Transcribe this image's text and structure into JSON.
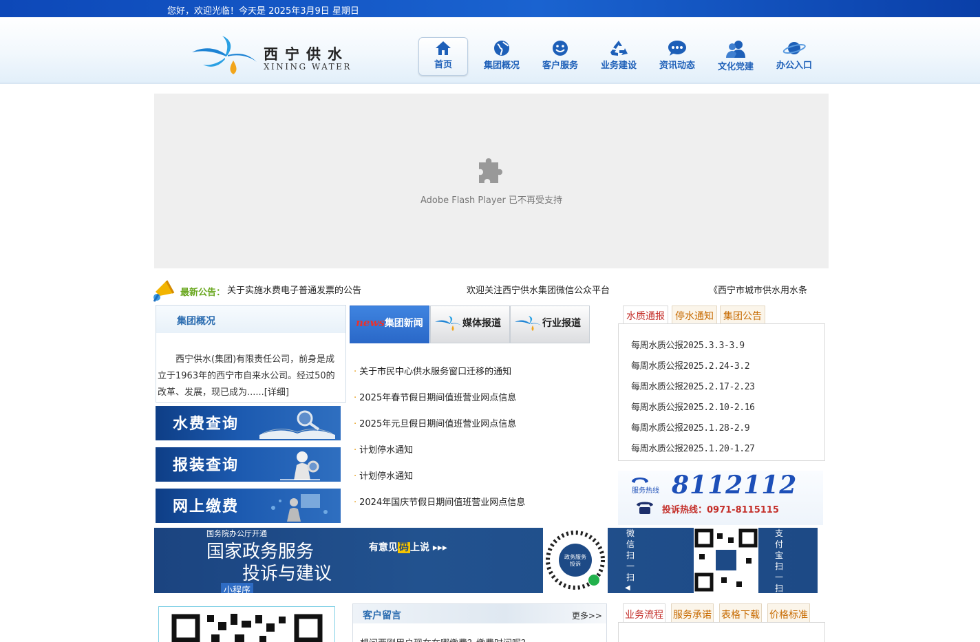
{
  "topbar": {
    "greeting": "您好，欢迎光临！今天是 2025年3月9日 星期日"
  },
  "logo": {
    "cn": "西宁供水",
    "en": "XINING WATER"
  },
  "nav": [
    {
      "label": "首页",
      "icon": "home-icon"
    },
    {
      "label": "集团概况",
      "icon": "globe-icon"
    },
    {
      "label": "客户服务",
      "icon": "smiley-icon"
    },
    {
      "label": "业务建设",
      "icon": "recycle-icon"
    },
    {
      "label": "资讯动态",
      "icon": "chat-icon"
    },
    {
      "label": "文化党建",
      "icon": "users-icon"
    },
    {
      "label": "办公入口",
      "icon": "planet-icon"
    }
  ],
  "flash": {
    "message": "Adobe Flash Player 已不再受支持"
  },
  "notice": {
    "label": "最新公告：",
    "items": [
      "关于实施水费电子普通发票的公告",
      "欢迎关注西宁供水集团微信公众平台",
      "《西宁市城市供水用水条"
    ]
  },
  "intro": {
    "title": "集团概况",
    "body": "西宁供水(集团)有限责任公司，前身是成立于1963年的西宁市自来水公司。经过50的改革、发展，现已成为......[详细]"
  },
  "quick_links": [
    "水费查询",
    "报装查询",
    "网上缴费"
  ],
  "news_tabs": {
    "tab1_prefix": "news",
    "tab1": "集团新闻",
    "tab2": "媒体报道",
    "tab3": "行业报道"
  },
  "news": [
    "关于市民中心供水服务窗口迁移的通知",
    "2025年春节假日期间值班营业网点信息",
    "2025年元旦假日期间值班营业网点信息",
    "计划停水通知",
    "计划停水通知",
    "2024年国庆节假日期间值班营业网点信息"
  ],
  "water_tabs": [
    "水质通报",
    "停水通知",
    "集团公告"
  ],
  "water_reports": [
    "每周水质公报2025.3.3-3.9",
    "每周水质公报2025.2.24-3.2",
    "每周水质公报2025.2.17-2.23",
    "每周水质公报2025.2.10-2.16",
    "每周水质公报2025.1.28-2.9",
    "每周水质公报2025.1.20-1.27"
  ],
  "hotline": {
    "tag": "服务热线",
    "number": "8112112",
    "complaint": "投诉热线：0971-8115115"
  },
  "banner": {
    "top": "国务院办公厅开通",
    "line1": "国家政务服务",
    "line2": "投诉与建议",
    "mini": "小程序",
    "slogan_pre": "有意见",
    "slogan_ma": "码",
    "slogan_post": "上说 ▸▸▸",
    "wechat": "微信扫一扫",
    "alipay": "支付宝扫一扫",
    "qr_caption": "政务服务投诉"
  },
  "message": {
    "title": "客户留言",
    "more": "更多>>",
    "first": "想问西刚用户现在在哪缴费？缴费时间呢？"
  },
  "bottom_tabs": [
    "业务流程",
    "服务承诺",
    "表格下载",
    "价格标准"
  ],
  "colors": {
    "nav_blue": "#1d5fb8",
    "top_bar": "#0d48b8",
    "notice_green": "#6aa820",
    "tab_orange": "#c76a00",
    "tab_red": "#c4302b"
  }
}
